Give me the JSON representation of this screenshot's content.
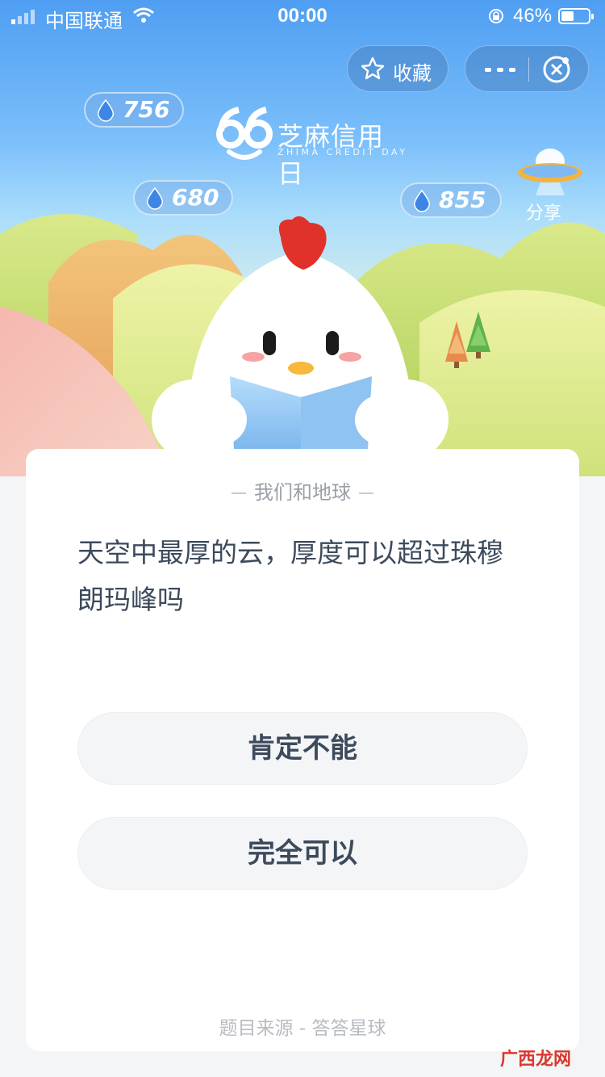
{
  "status_bar": {
    "carrier": "中国联通",
    "time": "00:00",
    "battery_percent": "46%",
    "battery_level": 0.46
  },
  "top_actions": {
    "favorite_label": "收藏",
    "share_label": "分享"
  },
  "points": {
    "bubble_1": "756",
    "bubble_2": "680",
    "bubble_3": "855"
  },
  "logo": {
    "number": "66",
    "title": "芝麻信用日",
    "subtitle": "ZHIMA CREDIT DAY"
  },
  "quiz": {
    "category": "我们和地球",
    "question": "天空中最厚的云，厚度可以超过珠穆朗玛峰吗",
    "answers": [
      "肯定不能",
      "完全可以"
    ],
    "source": "题目来源 - 答答星球"
  },
  "watermark": "广西龙网",
  "colors": {
    "accent_blue": "#4f9ef2",
    "question_text": "#3c4a5c",
    "answer_bg": "#f4f5f7",
    "chicken_comb": "#e0322b"
  },
  "icons": [
    "signal-icon",
    "wifi-icon",
    "rotation-lock-icon",
    "battery-icon",
    "star-icon",
    "more-icon",
    "close-icon",
    "drop-icon",
    "ufo-icon"
  ]
}
